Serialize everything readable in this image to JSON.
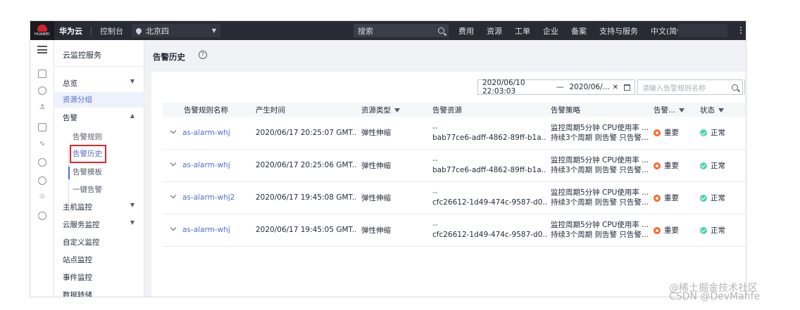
{
  "topbar": {
    "logo_text": "HUAWEI",
    "brand": "华为云",
    "console": "控制台",
    "region": "北京四",
    "search_placeholder": "搜索",
    "nav": [
      "费用",
      "资源",
      "工单",
      "企业",
      "备案",
      "支持与服务",
      "中文(简体)"
    ]
  },
  "sidebar": {
    "title": "云监控服务",
    "items": [
      {
        "label": "总览"
      },
      {
        "label": "资源分组"
      },
      {
        "label": "告警"
      },
      {
        "label": "告警规则"
      },
      {
        "label": "告警历史"
      },
      {
        "label": "告警模板"
      },
      {
        "label": "一键告警"
      },
      {
        "label": "主机监控"
      },
      {
        "label": "云服务监控"
      },
      {
        "label": "自定义监控"
      },
      {
        "label": "站点监控"
      },
      {
        "label": "事件监控"
      },
      {
        "label": "数据转储"
      }
    ]
  },
  "page": {
    "title": "告警历史",
    "help": "?"
  },
  "filters": {
    "date_start": "2020/06/10 22:03:03",
    "date_sep": "—",
    "date_end": "2020/06/...",
    "clear": "✕",
    "rule_search_placeholder": "请输入告警规则名称"
  },
  "table": {
    "columns": [
      "告警规则名称",
      "产生时间",
      "资源类型",
      "告警资源",
      "告警策略",
      "告警...",
      "状态"
    ],
    "rows": [
      {
        "rule": "as-alarm-whj",
        "time": "2020/06/17 20:25:07 GMT...",
        "type": "弹性伸缩",
        "res1": "--",
        "res2": "bab77ce6-adff-4862-89ff-b1a...",
        "pol1": "监控周期5分钟 CPU使用率 ...",
        "pol2": "持续3个周期 则告警 只告警...",
        "sev": "重要",
        "status": "正常"
      },
      {
        "rule": "as-alarm-whj",
        "time": "2020/06/17 20:25:06 GMT...",
        "type": "弹性伸缩",
        "res1": "--",
        "res2": "bab77ce6-adff-4862-89ff-b1a...",
        "pol1": "监控周期5分钟 CPU使用率 ...",
        "pol2": "持续3个周期 则告警 只告警...",
        "sev": "重要",
        "status": "正常"
      },
      {
        "rule": "as-alarm-whj2",
        "time": "2020/06/17 19:45:08 GMT...",
        "type": "弹性伸缩",
        "res1": "--",
        "res2": "cfc26612-1d49-474c-9587-d0...",
        "pol1": "监控周期5分钟 CPU使用率 ...",
        "pol2": "持续3个周期 则告警 只告警...",
        "sev": "重要",
        "status": "正常"
      },
      {
        "rule": "as-alarm-whj",
        "time": "2020/06/17 19:45:05 GMT...",
        "type": "弹性伸缩",
        "res1": "--",
        "res2": "cfc26612-1d49-474c-9587-d0...",
        "pol1": "监控周期5分钟 CPU使用率 ...",
        "pol2": "持续3个周期 则告警 只告警...",
        "sev": "重要",
        "status": "正常"
      }
    ]
  },
  "watermark": {
    "line1": "@稀土掘金技术社区",
    "line2": "CSDN @DevMahfe"
  },
  "colors": {
    "accent": "#526ecc",
    "severity_major": "#fa6828",
    "status_ok": "#50d4ab",
    "topbar": "#282b33",
    "highlight": "#e3262d"
  }
}
